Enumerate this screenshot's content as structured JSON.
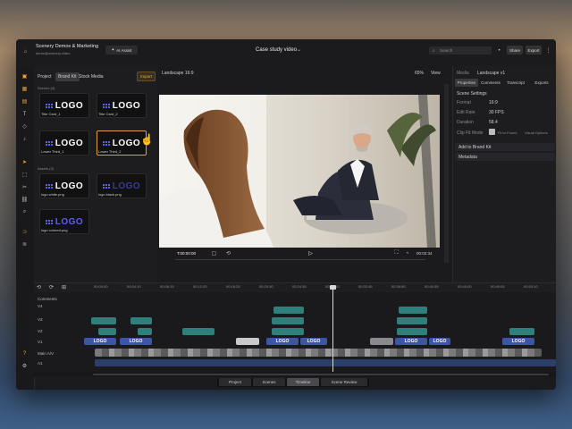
{
  "app": {
    "workspace": "Scenery Demos & Marketing",
    "email": "demo@scenery.video",
    "ai_assist": "AI Assist",
    "project_title": "Case study video",
    "search_placeholder": "Search",
    "share": "Share",
    "export": "Export"
  },
  "media_panel": {
    "tabs": [
      "Project",
      "Brand Kit",
      "Stock Media"
    ],
    "import": "Import",
    "section_scenes": "Scenes (4)",
    "section_assets": "Assets (3)",
    "items": [
      {
        "name": "Title Card_1"
      },
      {
        "name": "Title Card_2"
      },
      {
        "name": "Lower Third_1"
      },
      {
        "name": "Lower Third_2"
      },
      {
        "name": "logo white.png"
      },
      {
        "name": "logo black.png"
      },
      {
        "name": "logo colored.png"
      }
    ],
    "logo_text": "LOGO"
  },
  "viewer": {
    "aspect": "Landscape 16:9",
    "zoom": "65%",
    "view": "View",
    "timecode_current": "T:00:00:00",
    "timecode_total": "00:02:34"
  },
  "right_panel": {
    "header": [
      "Media",
      "Landscape v1"
    ],
    "tabs": [
      "Properties",
      "Comments",
      "Transcript",
      "Exports"
    ],
    "section": "Scene Settings",
    "rows": [
      {
        "label": "Format",
        "value": "16:9"
      },
      {
        "label": "Edit Rate",
        "value": "30 FPS"
      },
      {
        "label": "Duration",
        "value": "58.4"
      }
    ],
    "clip_fit": "Clip Fit Mode",
    "fit_option": "Fit to Frame",
    "options": "Visual Options",
    "add_brand": "Add to Brand Kit",
    "metadata": "Metadata"
  },
  "timeline": {
    "ticks": [
      "00:00:00",
      "00:04:10",
      "00:08:15",
      "00:12:20",
      "00:16:25",
      "00:20:30",
      "00:24:35",
      "00:28:40",
      "00:32:45",
      "00:36:50",
      "00:40:55",
      "00:45:00",
      "00:49:05",
      "00:53:10"
    ],
    "tracks": [
      "Comments",
      "V4",
      "V3",
      "V2",
      "V1",
      "Main A/V",
      "A1"
    ],
    "logo_text": "LOGO"
  },
  "bottom_tabs": [
    "Project",
    "Scenes",
    "Timeline",
    "Scene Review"
  ]
}
